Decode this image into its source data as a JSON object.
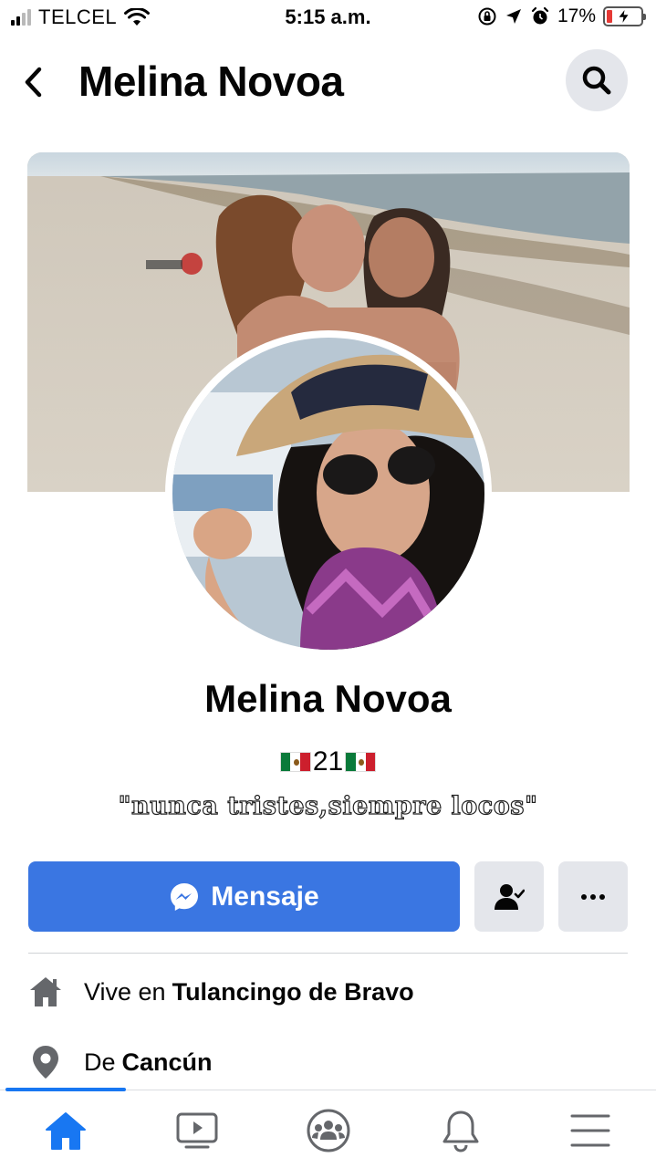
{
  "status_bar": {
    "carrier": "TELCEL",
    "time": "5:15 a.m.",
    "battery": "17%",
    "battery_level": 0.17,
    "icons": [
      "signal-icon",
      "wifi-icon",
      "orientation-lock-icon",
      "location-arrow-icon",
      "alarm-icon",
      "battery-charging-icon"
    ]
  },
  "header": {
    "title": "Melina Novoa",
    "back_icon": "chevron-left-icon",
    "search_icon": "search-icon"
  },
  "profile": {
    "name": "Melina Novoa",
    "bio_number": "21",
    "bio_flag_icon": "mexico-flag-icon",
    "quote": "\"nunca tristes,siempre locos\""
  },
  "actions": {
    "message_label": "Mensaje",
    "message_icon": "messenger-icon",
    "friend_icon": "friends-icon",
    "more_icon": "more-icon"
  },
  "info": [
    {
      "icon": "home-icon",
      "prefix": "Vive en",
      "value": "Tulancingo de Bravo"
    },
    {
      "icon": "location-pin-icon",
      "prefix": "De",
      "value": "Cancún"
    }
  ],
  "bottom_nav": {
    "items": [
      "home-icon",
      "watch-icon",
      "groups-icon",
      "notifications-icon",
      "menu-icon"
    ],
    "active": "home-icon"
  },
  "colors": {
    "accent": "#1877f2",
    "button_blue": "#3a76e2",
    "button_gray": "#e4e6eb",
    "text": "#050505"
  }
}
